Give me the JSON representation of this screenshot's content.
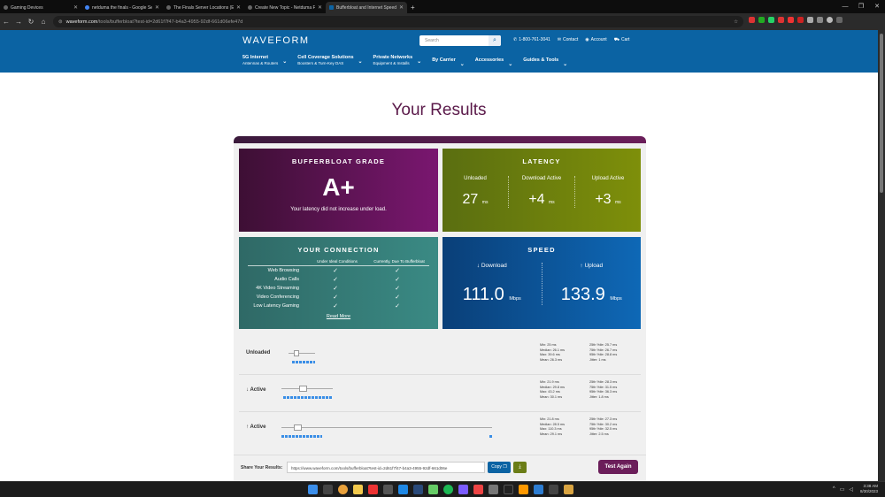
{
  "browser": {
    "tabs": [
      {
        "title": "Gaming Devices",
        "active": false
      },
      {
        "title": "netduma the finals - Google Se",
        "active": false
      },
      {
        "title": "The Finals Server Locations (Ea",
        "active": false
      },
      {
        "title": "Create New Topic - Netduma F",
        "active": false
      },
      {
        "title": "Bufferbloat and Internet Speed",
        "active": true
      }
    ],
    "new_tab": "+",
    "url_host": "waveform.com",
    "url_path": "/tools/bufferbloat?test-id=2d61f7f47-b4a3-4955-92df-661d06efe47d",
    "window_controls": [
      "—",
      "❐",
      "✕"
    ]
  },
  "site": {
    "logo": "WAVEFORM",
    "search_placeholder": "Search",
    "phone": "1-800-761-3041",
    "contact": "Contact",
    "account": "Account",
    "cart": "Cart",
    "nav": [
      {
        "label": "5G Internet",
        "sub": "Antennas & Routers"
      },
      {
        "label": "Cell Coverage Solutions",
        "sub": "Boosters & Turn-Key DAS"
      },
      {
        "label": "Private Networks",
        "sub": "Equipment & Installs"
      },
      {
        "label": "By Carrier",
        "sub": ""
      },
      {
        "label": "Accessories",
        "sub": ""
      },
      {
        "label": "Guides & Tools",
        "sub": ""
      }
    ]
  },
  "results": {
    "heading": "Your Results",
    "grade": {
      "title": "BUFFERBLOAT GRADE",
      "value": "A+",
      "subtitle": "Your latency did not increase under load."
    },
    "latency": {
      "title": "LATENCY",
      "columns": [
        {
          "label": "Unloaded",
          "value": "27",
          "unit": "ms"
        },
        {
          "label": "Download Active",
          "value": "+4",
          "unit": "ms"
        },
        {
          "label": "Upload Active",
          "value": "+3",
          "unit": "ms"
        }
      ]
    },
    "connection": {
      "title": "YOUR CONNECTION",
      "col1": "Under Ideal Conditions",
      "col2": "Currently, Due To Bufferbloat",
      "rows": [
        {
          "label": "Web Browsing",
          "ideal": "✓",
          "current": "✓"
        },
        {
          "label": "Audio Calls",
          "ideal": "✓",
          "current": "✓"
        },
        {
          "label": "4K Video Streaming",
          "ideal": "✓",
          "current": "✓"
        },
        {
          "label": "Video Conferencing",
          "ideal": "✓",
          "current": "✓"
        },
        {
          "label": "Low Latency Gaming",
          "ideal": "✓",
          "current": "✓"
        }
      ],
      "read_more": "Read More"
    },
    "speed": {
      "title": "SPEED",
      "download_label": "↓ Download",
      "download_value": "111.0",
      "upload_label": "↑ Upload",
      "upload_value": "133.9",
      "unit": "Mbps"
    },
    "stats": [
      {
        "name": "Unloaded",
        "left": [
          "Min: 25 ms",
          "Median: 26.1 ms",
          "Max: 39.6 ms",
          "Mean: 26.3 ms"
        ],
        "right": [
          "25th %ile: 25.7 ms",
          "75th %ile: 26.7 ms",
          "95th %ile: 28.8 ms",
          "Jitter: 1 ms"
        ]
      },
      {
        "name": "↓ Active",
        "left": [
          "Min: 21.9 ms",
          "Median: 29.8 ms",
          "Max: 43.2 ms",
          "Mean: 30.1 ms"
        ],
        "right": [
          "25th %ile: 28.3 ms",
          "75th %ile: 31.5 ms",
          "95th %ile: 36.3 ms",
          "Jitter: 1.8 ms"
        ]
      },
      {
        "name": "↑ Active",
        "left": [
          "Min: 21.8 ms",
          "Median: 28.5 ms",
          "Max: 110.3 ms",
          "Mean: 29.1 ms"
        ],
        "right": [
          "25th %ile: 27.3 ms",
          "75th %ile: 30.2 ms",
          "95th %ile: 32.5 ms",
          "Jitter: 2.5 ms"
        ]
      }
    ],
    "share_label": "Share Your Results:",
    "share_url": "https://www.waveform.com/tools/bufferbloat?test-id=2d61f7f47-b4a3-4955-92df-661d06e",
    "copy_label": "Copy",
    "test_again": "Test Again"
  },
  "taskbar": {
    "time": "3:38 AM",
    "date": "8/30/2023"
  }
}
